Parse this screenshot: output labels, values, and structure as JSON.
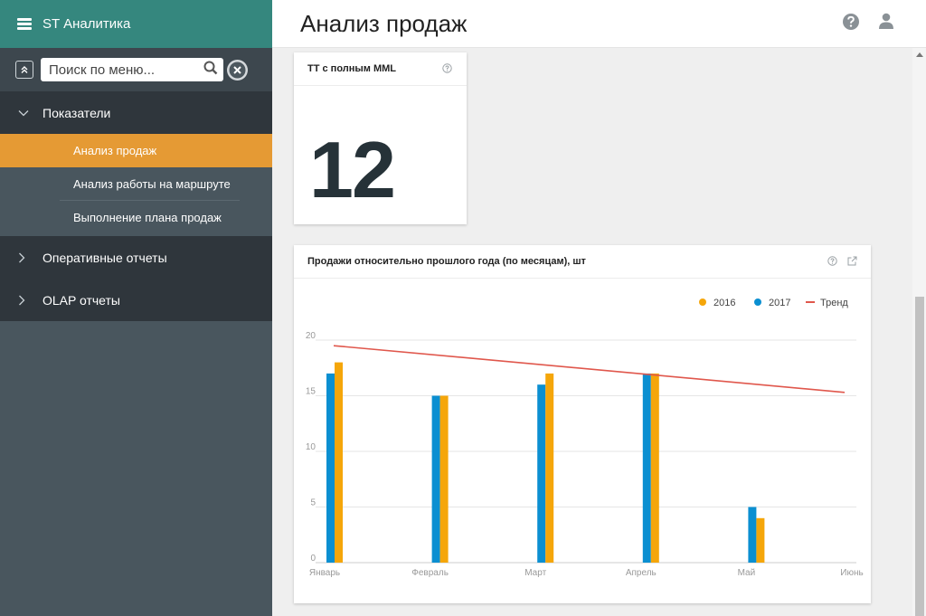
{
  "app": {
    "title": "ST Аналитика"
  },
  "search": {
    "placeholder": "Поиск по меню..."
  },
  "sidebar": {
    "groups": [
      {
        "label": "Показатели",
        "expanded": true,
        "items": [
          {
            "label": "Анализ продаж",
            "active": true
          },
          {
            "label": "Анализ работы на маршруте",
            "active": false
          },
          {
            "label": "Выполнение плана продаж",
            "active": false
          }
        ]
      },
      {
        "label": "Оперативные отчеты",
        "expanded": false
      },
      {
        "label": "OLAP отчеты",
        "expanded": false
      }
    ]
  },
  "header": {
    "title": "Анализ продаж"
  },
  "kpi": {
    "title": "ТТ с полным MML",
    "value": "12"
  },
  "icons": {
    "menu": "hamburger-icon",
    "collapse": "collapse-up-icon",
    "search": "search-icon",
    "clear": "clear-icon",
    "help": "help-icon",
    "user": "user-icon",
    "expand": "external-link-icon"
  },
  "colors": {
    "brand": "#35877e",
    "active": "#e59a34",
    "series2016": "#f5a60a",
    "series2017": "#0b8fd1",
    "trend": "#e0574c"
  },
  "chart_data": {
    "type": "bar",
    "title": "Продажи относительно прошлого года (по месяцам), шт",
    "categories": [
      "Январь",
      "Февраль",
      "Март",
      "Апрель",
      "Май",
      "Июнь"
    ],
    "series": [
      {
        "name": "2016",
        "values": [
          18,
          15,
          17,
          17,
          4,
          null
        ],
        "color": "#f5a60a"
      },
      {
        "name": "2017",
        "values": [
          17,
          15,
          16,
          17,
          5,
          null
        ],
        "color": "#0b8fd1"
      }
    ],
    "trend": {
      "name": "Тренд",
      "start": 19.5,
      "end": 15.3,
      "color": "#e0574c"
    },
    "yticks": [
      0,
      5,
      10,
      15,
      20
    ],
    "ylim": [
      0,
      20
    ],
    "legend": "top-right",
    "grid": true
  }
}
